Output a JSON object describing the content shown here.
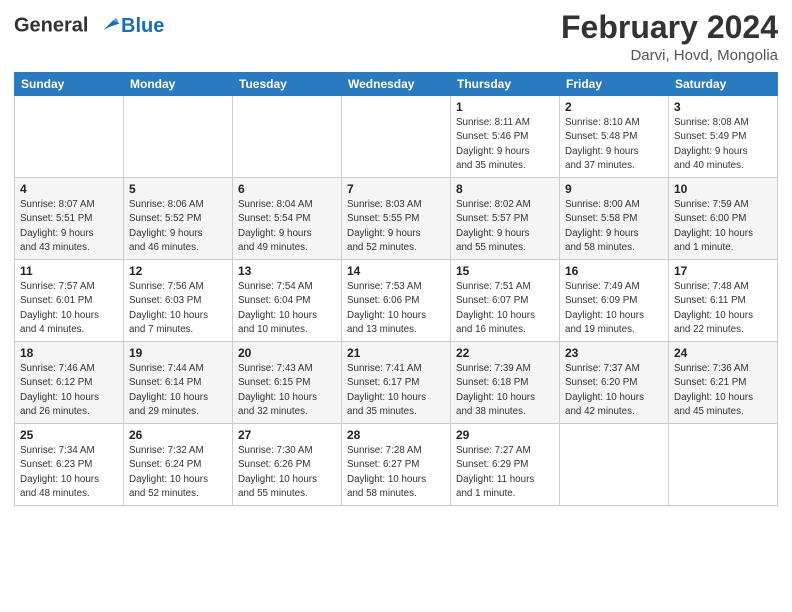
{
  "header": {
    "logo_line1": "General",
    "logo_line2": "Blue",
    "month_title": "February 2024",
    "location": "Darvi, Hovd, Mongolia"
  },
  "weekdays": [
    "Sunday",
    "Monday",
    "Tuesday",
    "Wednesday",
    "Thursday",
    "Friday",
    "Saturday"
  ],
  "weeks": [
    [
      {
        "day": "",
        "info": ""
      },
      {
        "day": "",
        "info": ""
      },
      {
        "day": "",
        "info": ""
      },
      {
        "day": "",
        "info": ""
      },
      {
        "day": "1",
        "info": "Sunrise: 8:11 AM\nSunset: 5:46 PM\nDaylight: 9 hours\nand 35 minutes."
      },
      {
        "day": "2",
        "info": "Sunrise: 8:10 AM\nSunset: 5:48 PM\nDaylight: 9 hours\nand 37 minutes."
      },
      {
        "day": "3",
        "info": "Sunrise: 8:08 AM\nSunset: 5:49 PM\nDaylight: 9 hours\nand 40 minutes."
      }
    ],
    [
      {
        "day": "4",
        "info": "Sunrise: 8:07 AM\nSunset: 5:51 PM\nDaylight: 9 hours\nand 43 minutes."
      },
      {
        "day": "5",
        "info": "Sunrise: 8:06 AM\nSunset: 5:52 PM\nDaylight: 9 hours\nand 46 minutes."
      },
      {
        "day": "6",
        "info": "Sunrise: 8:04 AM\nSunset: 5:54 PM\nDaylight: 9 hours\nand 49 minutes."
      },
      {
        "day": "7",
        "info": "Sunrise: 8:03 AM\nSunset: 5:55 PM\nDaylight: 9 hours\nand 52 minutes."
      },
      {
        "day": "8",
        "info": "Sunrise: 8:02 AM\nSunset: 5:57 PM\nDaylight: 9 hours\nand 55 minutes."
      },
      {
        "day": "9",
        "info": "Sunrise: 8:00 AM\nSunset: 5:58 PM\nDaylight: 9 hours\nand 58 minutes."
      },
      {
        "day": "10",
        "info": "Sunrise: 7:59 AM\nSunset: 6:00 PM\nDaylight: 10 hours\nand 1 minute."
      }
    ],
    [
      {
        "day": "11",
        "info": "Sunrise: 7:57 AM\nSunset: 6:01 PM\nDaylight: 10 hours\nand 4 minutes."
      },
      {
        "day": "12",
        "info": "Sunrise: 7:56 AM\nSunset: 6:03 PM\nDaylight: 10 hours\nand 7 minutes."
      },
      {
        "day": "13",
        "info": "Sunrise: 7:54 AM\nSunset: 6:04 PM\nDaylight: 10 hours\nand 10 minutes."
      },
      {
        "day": "14",
        "info": "Sunrise: 7:53 AM\nSunset: 6:06 PM\nDaylight: 10 hours\nand 13 minutes."
      },
      {
        "day": "15",
        "info": "Sunrise: 7:51 AM\nSunset: 6:07 PM\nDaylight: 10 hours\nand 16 minutes."
      },
      {
        "day": "16",
        "info": "Sunrise: 7:49 AM\nSunset: 6:09 PM\nDaylight: 10 hours\nand 19 minutes."
      },
      {
        "day": "17",
        "info": "Sunrise: 7:48 AM\nSunset: 6:11 PM\nDaylight: 10 hours\nand 22 minutes."
      }
    ],
    [
      {
        "day": "18",
        "info": "Sunrise: 7:46 AM\nSunset: 6:12 PM\nDaylight: 10 hours\nand 26 minutes."
      },
      {
        "day": "19",
        "info": "Sunrise: 7:44 AM\nSunset: 6:14 PM\nDaylight: 10 hours\nand 29 minutes."
      },
      {
        "day": "20",
        "info": "Sunrise: 7:43 AM\nSunset: 6:15 PM\nDaylight: 10 hours\nand 32 minutes."
      },
      {
        "day": "21",
        "info": "Sunrise: 7:41 AM\nSunset: 6:17 PM\nDaylight: 10 hours\nand 35 minutes."
      },
      {
        "day": "22",
        "info": "Sunrise: 7:39 AM\nSunset: 6:18 PM\nDaylight: 10 hours\nand 38 minutes."
      },
      {
        "day": "23",
        "info": "Sunrise: 7:37 AM\nSunset: 6:20 PM\nDaylight: 10 hours\nand 42 minutes."
      },
      {
        "day": "24",
        "info": "Sunrise: 7:36 AM\nSunset: 6:21 PM\nDaylight: 10 hours\nand 45 minutes."
      }
    ],
    [
      {
        "day": "25",
        "info": "Sunrise: 7:34 AM\nSunset: 6:23 PM\nDaylight: 10 hours\nand 48 minutes."
      },
      {
        "day": "26",
        "info": "Sunrise: 7:32 AM\nSunset: 6:24 PM\nDaylight: 10 hours\nand 52 minutes."
      },
      {
        "day": "27",
        "info": "Sunrise: 7:30 AM\nSunset: 6:26 PM\nDaylight: 10 hours\nand 55 minutes."
      },
      {
        "day": "28",
        "info": "Sunrise: 7:28 AM\nSunset: 6:27 PM\nDaylight: 10 hours\nand 58 minutes."
      },
      {
        "day": "29",
        "info": "Sunrise: 7:27 AM\nSunset: 6:29 PM\nDaylight: 11 hours\nand 1 minute."
      },
      {
        "day": "",
        "info": ""
      },
      {
        "day": "",
        "info": ""
      }
    ]
  ]
}
